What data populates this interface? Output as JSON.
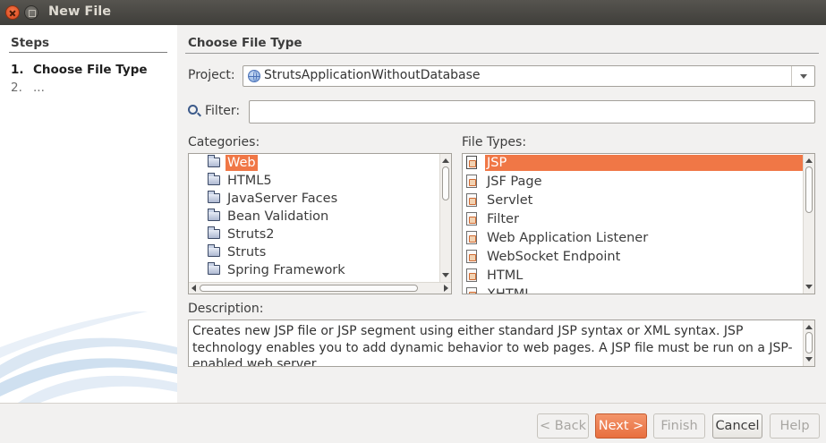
{
  "window": {
    "title": "New File"
  },
  "steps": {
    "heading": "Steps",
    "items": [
      {
        "num": "1.",
        "label": "Choose File Type"
      },
      {
        "num": "2.",
        "label": "..."
      }
    ]
  },
  "main": {
    "heading": "Choose File Type",
    "project_label": "Project:",
    "project_value": "StrutsApplicationWithoutDatabase",
    "filter_label": "Filter:",
    "filter_value": "",
    "categories_label": "Categories:",
    "categories": [
      "Web",
      "HTML5",
      "JavaServer Faces",
      "Bean Validation",
      "Struts2",
      "Struts",
      "Spring Framework"
    ],
    "categories_selected": "Web",
    "file_types_label": "File Types:",
    "file_types": [
      "JSP",
      "JSF Page",
      "Servlet",
      "Filter",
      "Web Application Listener",
      "WebSocket Endpoint",
      "HTML",
      "XHTML"
    ],
    "file_types_selected": "JSP",
    "description_label": "Description:",
    "description": "Creates new JSP file or JSP segment using either standard JSP syntax or XML syntax. JSP technology enables you to add dynamic behavior to web pages. A JSP file must be run on a JSP-enabled web server."
  },
  "buttons": {
    "back": "< Back",
    "next": "Next >",
    "finish": "Finish",
    "cancel": "Cancel",
    "help": "Help"
  },
  "colors": {
    "selection": "#f07746",
    "titlebar": "#4a4844",
    "primary_button": "#e8784a"
  }
}
